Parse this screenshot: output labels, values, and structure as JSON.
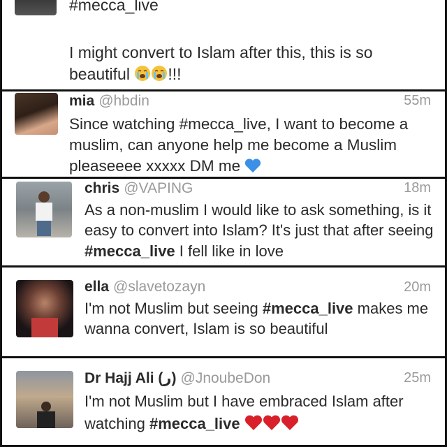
{
  "tweets": [
    {
      "hashtag_line": "#mecca_live",
      "text": "I might convert to Islam after this, this is so beautiful",
      "tail": "!!!"
    },
    {
      "name": "mia",
      "handle": "@hbdin",
      "time": "55m",
      "text": "Since watching #mecca_live, I want to become a muslim, can anyone help me become a Muslim pleaseeee xxxxx DM me"
    },
    {
      "name": "chris",
      "handle": "@VAPING",
      "time": "18m",
      "text_before": "As a non-muslim I would like to ask something, is it easy to convert into Islam? It's just that after seeing ",
      "hashtag": "#mecca_live",
      "text_after": " I fell like in love"
    },
    {
      "name": "ella",
      "handle": "@slavetozayn",
      "time": "20m",
      "text_before": "I'm not Muslim but seeing ",
      "hashtag": "#mecca_live",
      "text_after": " makes me wanna convert, Islam is so beautiful"
    },
    {
      "name": "Dr Hajj Ali (ر)",
      "handle": "@JnoubeDon",
      "time": "25m",
      "text_before": "I'm not Muslim but I have embraced Islam after watching ",
      "hashtag": "#mecca_live"
    }
  ],
  "colors": {
    "handle_grey": "#9a9a9a",
    "text_dark": "#2a2a2a",
    "heart_red": "#d9202a",
    "blue_heart": "#3b8fe6",
    "border": "#111111"
  },
  "icons": [
    "crying-face-emoji",
    "blue-heart-emoji",
    "red-heart-emoji"
  ]
}
